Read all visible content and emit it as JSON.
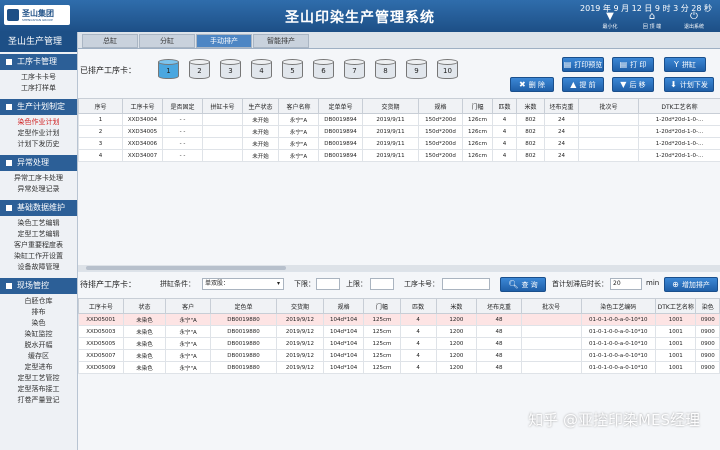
{
  "app": {
    "logo_text": "圣山集团",
    "logo_sub": "SHENGSHAN GROUP",
    "title": "圣山印染生产管理系统",
    "datetime": "2019 年 9 月 12 日   9 时 3 分 28 秒",
    "win_buttons": [
      {
        "label": "最小化",
        "icon": "down-arrow-icon",
        "glyph": "▼"
      },
      {
        "label": "回 顶 端",
        "icon": "home-icon",
        "glyph": "⌂"
      },
      {
        "label": "退出系统",
        "icon": "power-icon",
        "glyph": "⏻"
      }
    ]
  },
  "sidebar": {
    "header": "圣山生产管理",
    "sections": [
      {
        "title": "工序卡管理",
        "items": [
          "工序卡卡号",
          "工序打样单"
        ]
      },
      {
        "title": "生产计划制定",
        "items": [
          "染色作业计划",
          "定型作业计划",
          "计划下发历史"
        ]
      },
      {
        "title": "异常处理",
        "items": [
          "异常工序卡处理",
          "异常处理记录"
        ]
      },
      {
        "title": "基础数据维护",
        "items": [
          "染色工艺编辑",
          "定型工艺编辑",
          "客户重要程度表",
          "染缸工作开设置",
          "设备故障管理"
        ]
      },
      {
        "title": "现场管控",
        "items": [
          "白胚仓库",
          "排布",
          "染色",
          "染缸监控",
          "脱水开幅",
          "缓存区",
          "定型进布",
          "定型工艺管控",
          "定型落布接工",
          "打卷严量登记"
        ]
      }
    ],
    "active_item": "染色作业计划"
  },
  "tabs": [
    "总缸",
    "分缸",
    "手动排产",
    "智能排产"
  ],
  "active_tab": "手动排产",
  "scheduled": {
    "label": "已排产工序卡：",
    "cards": [
      "1",
      "2",
      "3",
      "4",
      "5",
      "6",
      "7",
      "8",
      "9",
      "10"
    ],
    "selected_card": "1",
    "buttons": [
      {
        "label": "打印预览",
        "icon": "print-preview-icon",
        "glyph": "▤"
      },
      {
        "label": "打 印",
        "icon": "printer-icon",
        "glyph": "▤"
      },
      {
        "label": "拼缸",
        "icon": "merge-icon",
        "glyph": "Y"
      },
      {
        "label": "删 除",
        "icon": "delete-icon",
        "glyph": "✖"
      },
      {
        "label": "提 前",
        "icon": "up-icon",
        "glyph": "▲"
      },
      {
        "label": "后 移",
        "icon": "down-icon",
        "glyph": "▼"
      },
      {
        "label": "计划下发",
        "icon": "send-icon",
        "glyph": "⬇"
      }
    ],
    "columns": [
      "序号",
      "工序卡号",
      "是否固定",
      "拼缸卡号",
      "生产状态",
      "客户名称",
      "定单单号",
      "交货期",
      "规格",
      "门幅",
      "匹数",
      "米数",
      "坯布克重",
      "批次号",
      "DTK工艺名称"
    ],
    "rows": [
      [
        "1",
        "XXD34004",
        "- -",
        "",
        "未开始",
        "永宁\"A",
        "DB0019894",
        "2019/9/11",
        "150d*200d",
        "126cm",
        "4",
        "802",
        "24",
        "",
        "1-20d*20d-1-0-..."
      ],
      [
        "2",
        "XXD34005",
        "- -",
        "",
        "未开始",
        "永宁\"A",
        "DB0019894",
        "2019/9/11",
        "150d*200d",
        "126cm",
        "4",
        "802",
        "24",
        "",
        "1-20d*20d-1-0-..."
      ],
      [
        "3",
        "XXD34006",
        "- -",
        "",
        "未开始",
        "永宁\"A",
        "DB0019894",
        "2019/9/11",
        "150d*200d",
        "126cm",
        "4",
        "802",
        "24",
        "",
        "1-20d*20d-1-0-..."
      ],
      [
        "4",
        "XXD34007",
        "- -",
        "",
        "未开始",
        "永宁\"A",
        "DB0019894",
        "2019/9/11",
        "150d*200d",
        "126cm",
        "4",
        "802",
        "24",
        "",
        "1-20d*20d-1-0-..."
      ]
    ]
  },
  "pending": {
    "label": "待排产工序卡：",
    "filter_label": "拼缸条件：",
    "select_value": "单双股：",
    "lower_label": "下限：",
    "upper_label": "上限：",
    "card_label": "工序卡号：",
    "search_button": "查 询",
    "first_plan_label": "首计划滞后时长：",
    "first_plan_value": "20",
    "first_plan_unit": "min",
    "add_button": "增加排产",
    "columns": [
      "工序卡号",
      "状态",
      "客户",
      "定色单",
      "交货期",
      "规格",
      "门幅",
      "匹数",
      "米数",
      "坯布克重",
      "批次号",
      "染色工艺编码",
      "DTK工艺名称",
      "染色"
    ],
    "rows": [
      [
        "XXD05001",
        "未染色",
        "永宁\"A",
        "DB0019880",
        "2019/9/12",
        "104d*104",
        "125cm",
        "4",
        "1200",
        "48",
        "",
        "01-0-1-0-0-a-0-10*10",
        "1001",
        "0900"
      ],
      [
        "XXD05003",
        "未染色",
        "永宁\"A",
        "DB0019880",
        "2019/9/12",
        "104d*104",
        "125cm",
        "4",
        "1200",
        "48",
        "",
        "01-0-1-0-0-a-0-10*10",
        "1001",
        "0900"
      ],
      [
        "XXD05005",
        "未染色",
        "永宁\"A",
        "DB0019880",
        "2019/9/12",
        "104d*104",
        "125cm",
        "4",
        "1200",
        "48",
        "",
        "01-0-1-0-0-a-0-10*10",
        "1001",
        "0900"
      ],
      [
        "XXD05007",
        "未染色",
        "永宁\"A",
        "DB0019880",
        "2019/9/12",
        "104d*104",
        "125cm",
        "4",
        "1200",
        "48",
        "",
        "01-0-1-0-0-a-0-10*10",
        "1001",
        "0900"
      ],
      [
        "XXD05009",
        "未染色",
        "永宁\"A",
        "DB0019880",
        "2019/9/12",
        "104d*104",
        "125cm",
        "4",
        "1200",
        "48",
        "",
        "01-0-1-0-0-a-0-10*10",
        "1001",
        "0900"
      ]
    ]
  },
  "watermark": "知乎 @亚控印染MES经理"
}
